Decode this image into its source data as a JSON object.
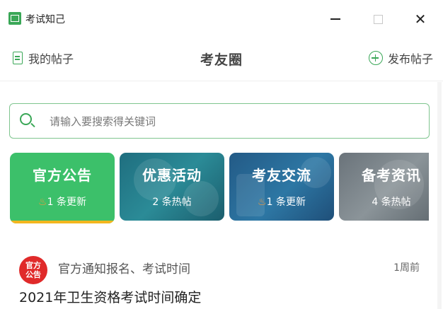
{
  "window": {
    "app_title": "考试知己",
    "minimize": "",
    "maximize": "",
    "close": "✕"
  },
  "header": {
    "my_posts": "我的帖子",
    "title": "考友圈",
    "publish": "发布帖子"
  },
  "search": {
    "placeholder": "请输入要搜索得关键词"
  },
  "cards": [
    {
      "title": "官方公告",
      "count": "1",
      "suffix": "条更新",
      "icon": "flame-icon"
    },
    {
      "title": "优惠活动",
      "count": "2",
      "suffix": "条热帖"
    },
    {
      "title": "考友交流",
      "count": "1",
      "suffix": "条更新",
      "icon": "flame-icon"
    },
    {
      "title": "备考资讯",
      "count": "4",
      "suffix": "条热帖"
    }
  ],
  "post": {
    "badge_line1": "官方",
    "badge_line2": "公告",
    "category": "官方通知报名、考试时间",
    "time": "1周前",
    "title": "2021年卫生资格考试时间确定"
  },
  "colors": {
    "accent": "#3aa757",
    "card_official": "#3cc06a",
    "badge": "#e02a2a"
  }
}
